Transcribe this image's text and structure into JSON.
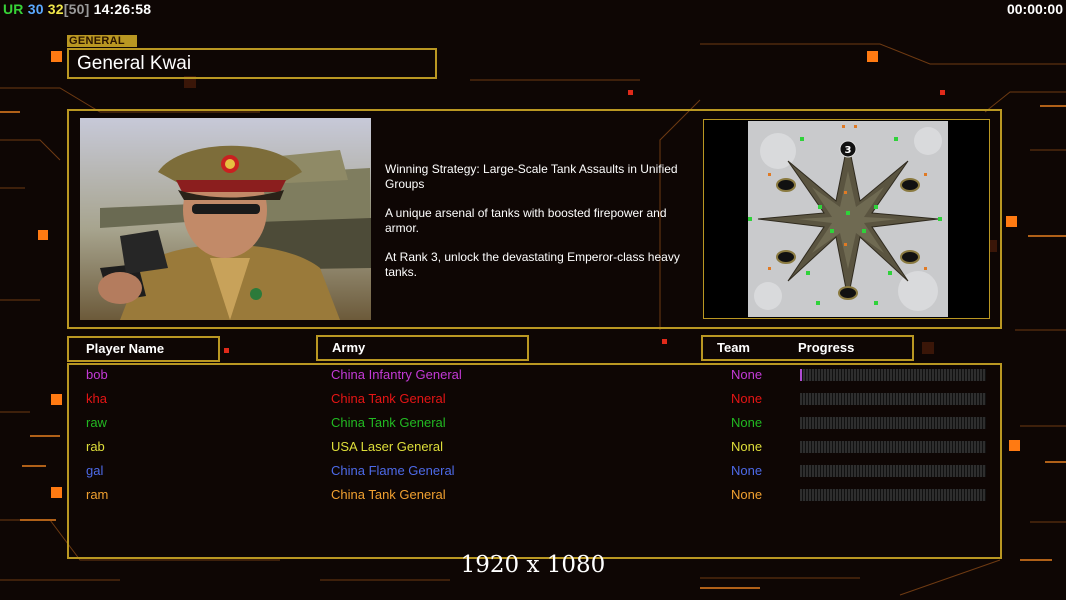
{
  "hud": {
    "ur_label": "UR",
    "val1": "30",
    "val2": "32",
    "bracket_val": "[50]",
    "clock": "14:26:58",
    "timer": "00:00:00"
  },
  "general": {
    "tag": "GENERAL",
    "name": "General Kwai",
    "description": [
      "Winning Strategy: Large-Scale Tank Assaults in Unified\n Groups",
      "A unique arsenal of tanks with boosted firepower and\n armor.",
      "At Rank 3, unlock the devastating Emperor-class heavy\n tanks."
    ]
  },
  "map": {
    "marker": "3"
  },
  "table": {
    "headers": {
      "player": "Player Name",
      "army": "Army",
      "team": "Team",
      "progress": "Progress"
    },
    "rows": [
      {
        "name": "bob",
        "army": "China Infantry General",
        "team": "None",
        "color": "#c33ad6",
        "progress": 0.01
      },
      {
        "name": "kha",
        "army": "China Tank General",
        "team": "None",
        "color": "#e51515",
        "progress": 0
      },
      {
        "name": "raw",
        "army": "China Tank General",
        "team": "None",
        "color": "#22b922",
        "progress": 0
      },
      {
        "name": "rab",
        "army": "USA Laser General",
        "team": "None",
        "color": "#dede3a",
        "progress": 0
      },
      {
        "name": "gal",
        "army": "China Flame General",
        "team": "None",
        "color": "#4d6ae8",
        "progress": 0
      },
      {
        "name": "ram",
        "army": "China Tank General",
        "team": "None",
        "color": "#f0a030",
        "progress": 0
      }
    ]
  },
  "resolution": "1920 x 1080",
  "colors": {
    "accent": "#b99722",
    "background": "#0e0604"
  }
}
